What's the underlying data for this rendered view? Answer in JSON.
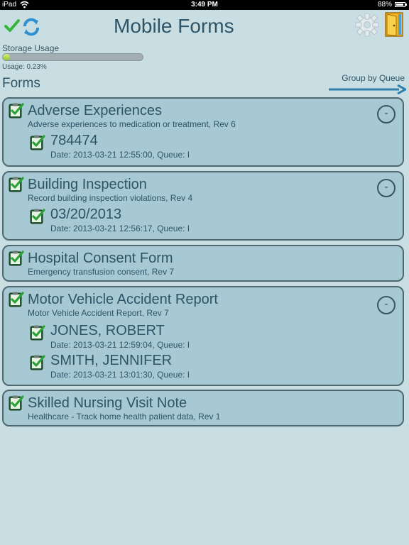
{
  "status_bar": {
    "carrier": "iPad",
    "time": "3:49 PM",
    "battery": "88%"
  },
  "header": {
    "title": "Mobile Forms"
  },
  "storage": {
    "label": "Storage Usage",
    "usage_text": "Usage: 0.23%",
    "usage_fraction": 0.0023
  },
  "forms_heading": "Forms",
  "group_by_label": "Group by Queue",
  "forms": [
    {
      "title": "Adverse Experiences",
      "description": "Adverse experiences to medication or treatment, Rev 6",
      "collapse": "-",
      "entries": [
        {
          "title": "784474",
          "date": "Date: 2013-03-21 12:55:00, Queue: I"
        }
      ]
    },
    {
      "title": "Building Inspection",
      "description": "Record building inspection violations, Rev 4",
      "collapse": "-",
      "entries": [
        {
          "title": "03/20/2013",
          "date": "Date: 2013-03-21 12:56:17, Queue: I"
        }
      ]
    },
    {
      "title": "Hospital Consent Form",
      "description": "Emergency transfusion consent, Rev 7",
      "entries": []
    },
    {
      "title": "Motor Vehicle Accident Report",
      "description": "Motor Vehicle Accident Report, Rev 7",
      "collapse": "-",
      "entries": [
        {
          "title": "JONES, ROBERT",
          "date": "Date: 2013-03-21 12:59:04, Queue: I"
        },
        {
          "title": "SMITH, JENNIFER",
          "date": "Date: 2013-03-21 13:01:30, Queue: I"
        }
      ]
    },
    {
      "title": "Skilled Nursing Visit Note",
      "description": "Healthcare - Track home health patient data, Rev 1",
      "entries": []
    }
  ]
}
